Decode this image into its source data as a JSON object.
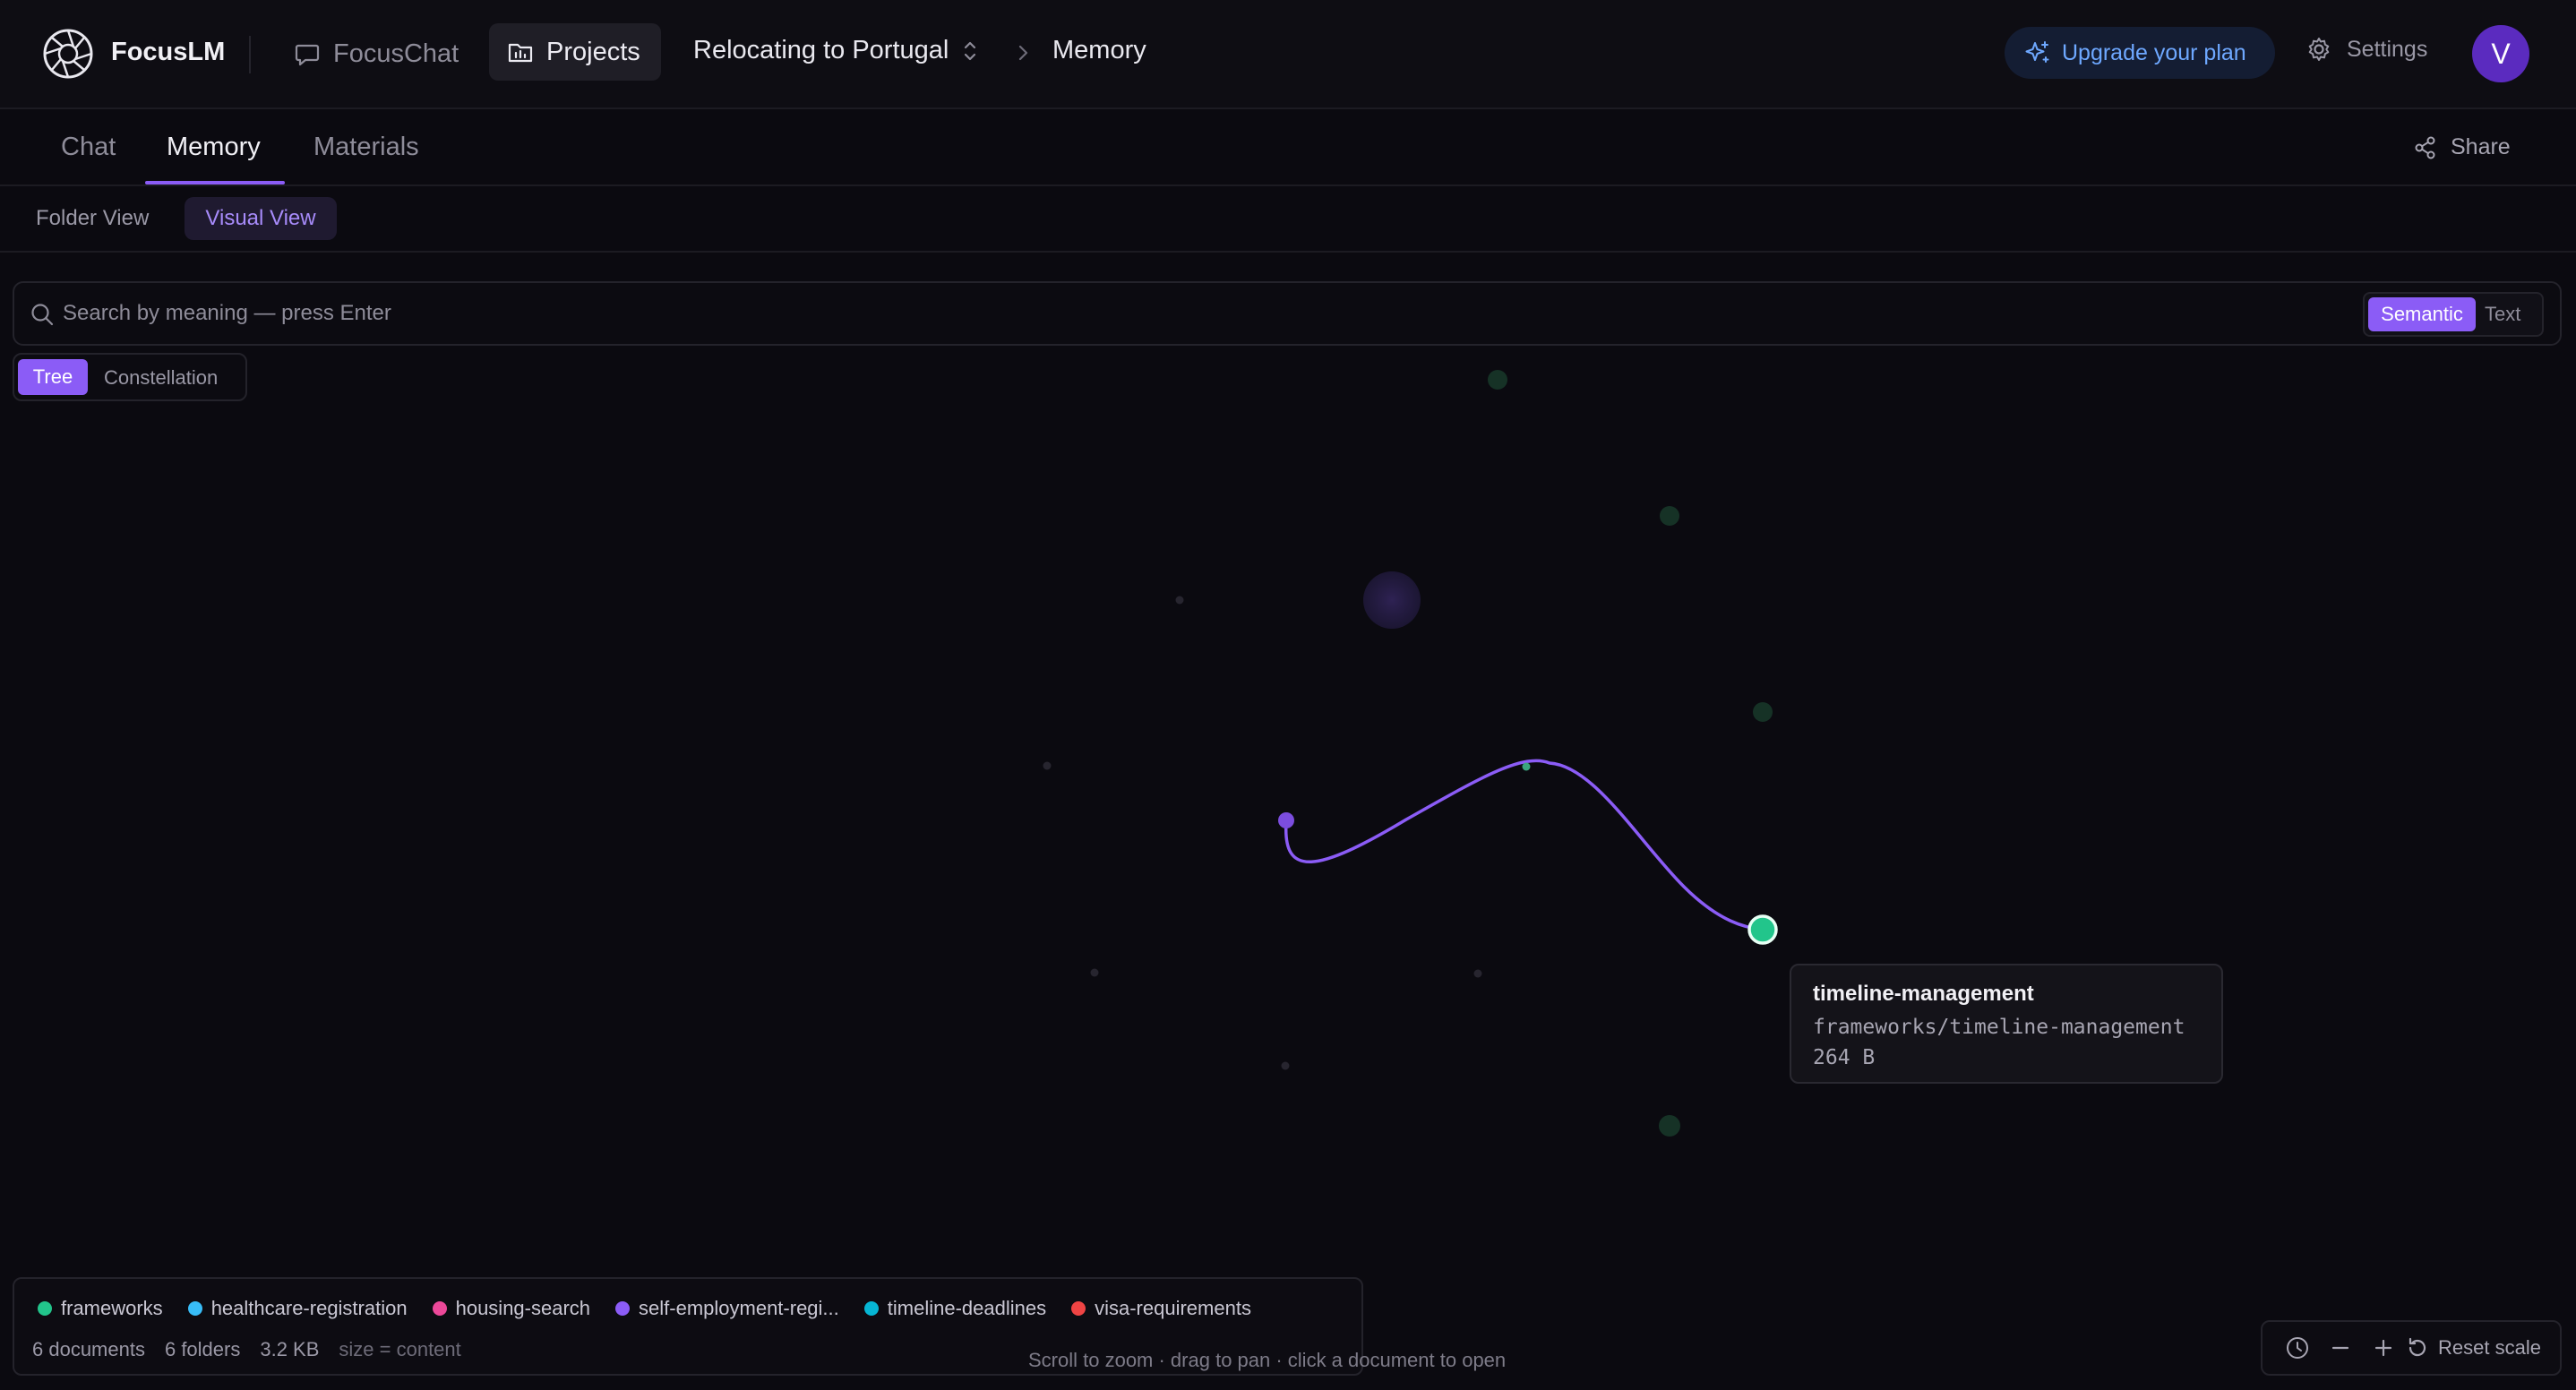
{
  "app": {
    "name": "FocusLM"
  },
  "nav": {
    "chat_label": "FocusChat",
    "projects_label": "Projects",
    "project_name": "Relocating to Portugal",
    "current_page": "Memory"
  },
  "header": {
    "upgrade_label": "Upgrade your plan",
    "settings_label": "Settings",
    "avatar_initial": "V"
  },
  "tabs": [
    {
      "label": "Chat",
      "active": false
    },
    {
      "label": "Memory",
      "active": true
    },
    {
      "label": "Materials",
      "active": false
    }
  ],
  "share_label": "Share",
  "views": {
    "folder": "Folder View",
    "visual": "Visual View",
    "active": "visual"
  },
  "search": {
    "placeholder": "Search by meaning — press Enter",
    "value": "",
    "modes": {
      "semantic": "Semantic",
      "text": "Text",
      "active": "semantic"
    }
  },
  "layout_modes": {
    "tree": "Tree",
    "constellation": "Constellation",
    "active": "tree"
  },
  "tooltip": {
    "title": "timeline-management",
    "path": "frameworks/timeline-management",
    "size": "264 B"
  },
  "legend": {
    "items": [
      {
        "label": "frameworks",
        "color": "#22c58b"
      },
      {
        "label": "healthcare-registration",
        "color": "#38bdf8"
      },
      {
        "label": "housing-search",
        "color": "#ec4899"
      },
      {
        "label": "self-employment-regi...",
        "color": "#8b5cf6"
      },
      {
        "label": "timeline-deadlines",
        "color": "#06b6d4"
      },
      {
        "label": "visa-requirements",
        "color": "#ef4444"
      }
    ],
    "stats": {
      "documents": "6 documents",
      "folders": "6 folders",
      "size": "3.2 KB",
      "size_note": "size = content"
    }
  },
  "hint": "Scroll to zoom · drag to pan · click a document to open",
  "zoom": {
    "reset_label": "Reset scale"
  },
  "colors": {
    "accent": "#8b5cf6",
    "link": "#8b5cf6",
    "active_node": "#22c58b",
    "upgrade_text": "#6ea8ff"
  }
}
